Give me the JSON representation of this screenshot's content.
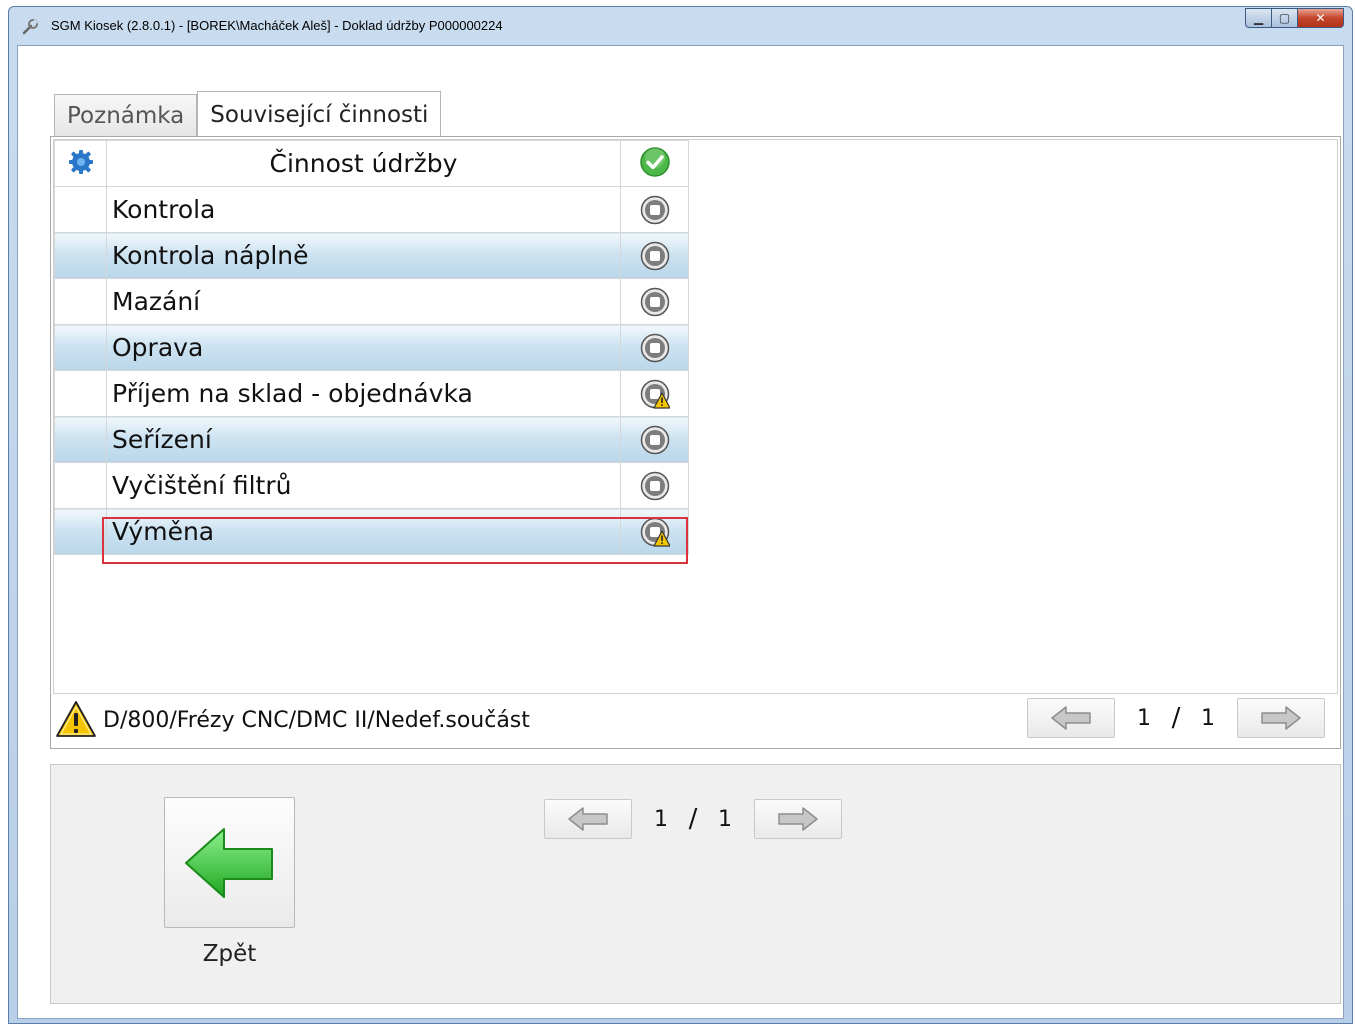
{
  "window": {
    "title": "SGM Kiosek (2.8.0.1) - [BOREK\\Macháček Aleš] - Doklad údržby P000000224",
    "min_label": "▁",
    "max_label": "▢",
    "close_label": "✕"
  },
  "tabs": [
    {
      "label": "Poznámka",
      "active": false
    },
    {
      "label": "Související činnosti",
      "active": true
    }
  ],
  "table": {
    "header": {
      "name": "Činnost údržby"
    },
    "rows": [
      {
        "name": "Kontrola",
        "status": "stop-icon"
      },
      {
        "name": "Kontrola náplně",
        "status": "stop-icon"
      },
      {
        "name": "Mazání",
        "status": "stop-icon"
      },
      {
        "name": "Oprava",
        "status": "stop-icon"
      },
      {
        "name": "Příjem na sklad - objednávka",
        "status": "stop-warning-icon"
      },
      {
        "name": "Seřízení",
        "status": "stop-icon"
      },
      {
        "name": "Vyčištění filtrů",
        "status": "stop-icon"
      },
      {
        "name": "Výměna",
        "status": "stop-warning-icon",
        "selected": true
      }
    ]
  },
  "footer": {
    "path": "D/800/Frézy CNC/DMC II/Nedef.součást",
    "pager": {
      "current": "1",
      "separator": "/",
      "total": "1"
    }
  },
  "bottom": {
    "pager": {
      "current": "1",
      "separator": "/",
      "total": "1"
    },
    "back_label": "Zpět"
  },
  "colors": {
    "selection_border": "#d9343d",
    "alt_row": "#cde3f1",
    "back_arrow": "#3fbf3f",
    "check": "#4cb848",
    "warning": "#f5c400"
  }
}
